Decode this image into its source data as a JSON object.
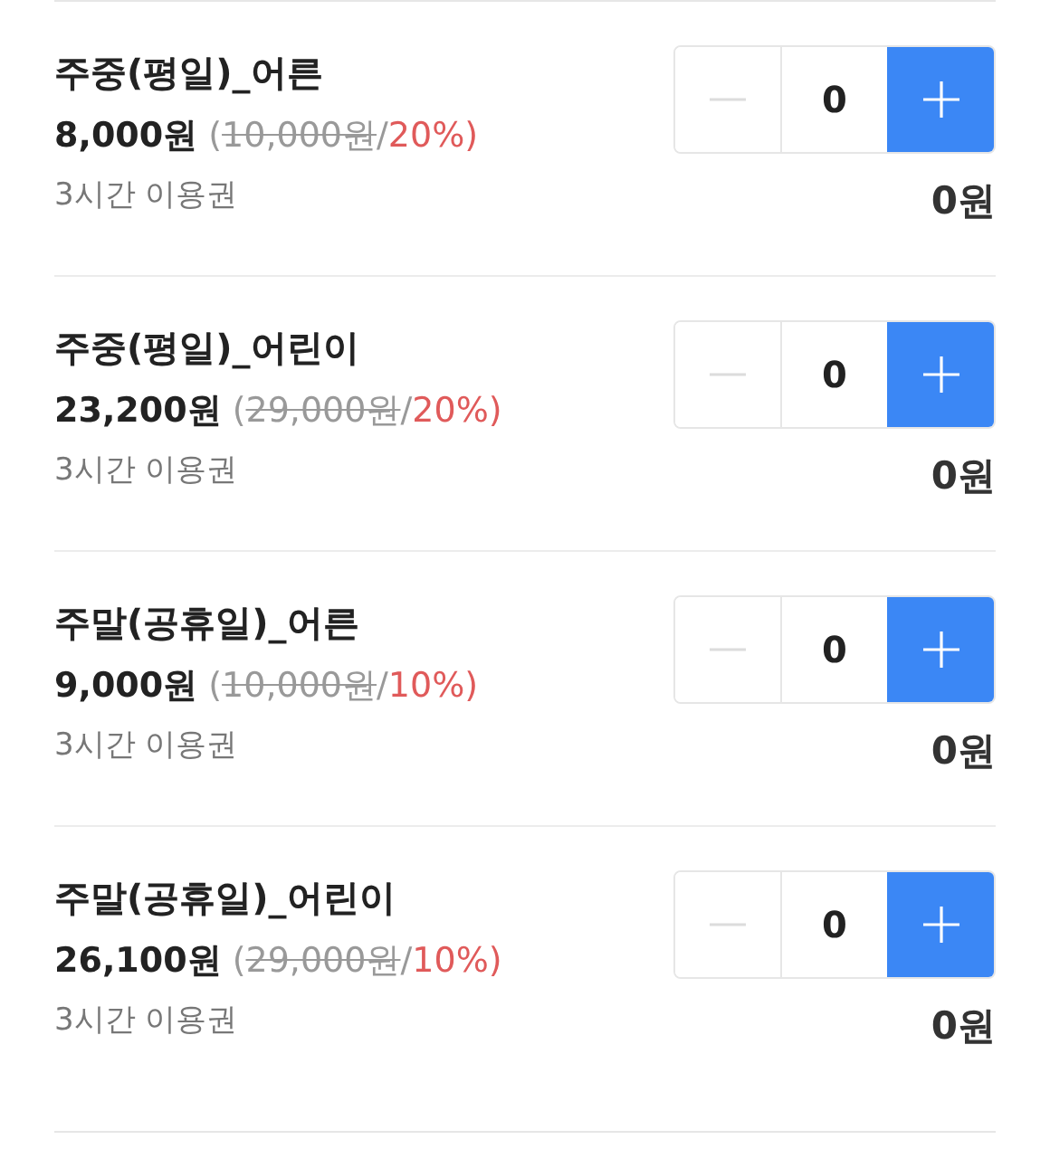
{
  "tickets": [
    {
      "name": "주중(평일)_어른",
      "price": "8,000원",
      "open": "(",
      "original_price": "10,000원",
      "separator": "/",
      "discount": "20%",
      "close": ")",
      "description": "3시간 이용권",
      "quantity": "0",
      "total": "0원",
      "minus_disabled": true
    },
    {
      "name": "주중(평일)_어린이",
      "price": "23,200원",
      "open": "(",
      "original_price": "29,000원",
      "separator": "/",
      "discount": "20%",
      "close": ")",
      "description": "3시간 이용권",
      "quantity": "0",
      "total": "0원",
      "minus_disabled": true
    },
    {
      "name": "주말(공휴일)_어른",
      "price": "9,000원",
      "open": "(",
      "original_price": "10,000원",
      "separator": "/",
      "discount": "10%",
      "close": ")",
      "description": "3시간 이용권",
      "quantity": "0",
      "total": "0원",
      "minus_disabled": true
    },
    {
      "name": "주말(공휴일)_어린이",
      "price": "26,100원",
      "open": "(",
      "original_price": "29,000원",
      "separator": "/",
      "discount": "10%",
      "close": ")",
      "description": "3시간 이용권",
      "quantity": "0",
      "total": "0원",
      "minus_disabled": true
    }
  ]
}
